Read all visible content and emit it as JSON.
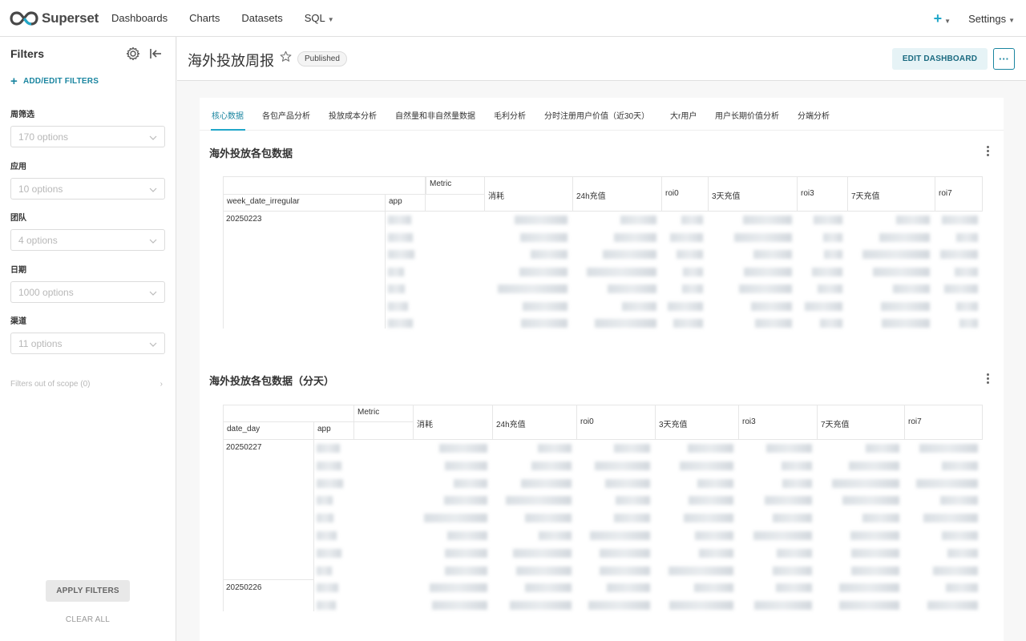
{
  "nav": {
    "brand": "Superset",
    "links": [
      {
        "label": "Dashboards"
      },
      {
        "label": "Charts"
      },
      {
        "label": "Datasets"
      },
      {
        "label": "SQL"
      }
    ],
    "plus": "+",
    "settings": "Settings"
  },
  "sidebar": {
    "title": "Filters",
    "add_filters": "ADD/EDIT FILTERS",
    "filters": [
      {
        "label": "周筛选",
        "placeholder": "170 options"
      },
      {
        "label": "应用",
        "placeholder": "10 options"
      },
      {
        "label": "团队",
        "placeholder": "4 options"
      },
      {
        "label": "日期",
        "placeholder": "1000 options"
      },
      {
        "label": "渠道",
        "placeholder": "11 options"
      }
    ],
    "scope": "Filters out of scope (0)",
    "apply": "APPLY FILTERS",
    "clear": "CLEAR ALL"
  },
  "header": {
    "title": "海外投放周报",
    "badge": "Published",
    "edit": "EDIT DASHBOARD",
    "more": "···"
  },
  "tabs": [
    {
      "label": "核心数据"
    },
    {
      "label": "各包产品分析"
    },
    {
      "label": "投放成本分析"
    },
    {
      "label": "自然量和非自然量数据"
    },
    {
      "label": "毛利分析"
    },
    {
      "label": "分时注册用户价值（近30天）"
    },
    {
      "label": "大r用户"
    },
    {
      "label": "用户长期价值分析"
    },
    {
      "label": "分端分析"
    }
  ],
  "chart1": {
    "title": "海外投放各包数据",
    "metric": "Metric",
    "row_headers": [
      "week_date_irregular",
      "app"
    ],
    "columns": [
      "消耗",
      "24h充值",
      "roi0",
      "3天充值",
      "roi3",
      "7天充值",
      "roi7"
    ],
    "rows": [
      {
        "label": "20250223"
      }
    ]
  },
  "chart2": {
    "title": "海外投放各包数据（分天）",
    "metric": "Metric",
    "row_headers": [
      "date_day",
      "app"
    ],
    "columns": [
      "消耗",
      "24h充值",
      "roi0",
      "3天充值",
      "roi3",
      "7天充值",
      "roi7"
    ],
    "rows": [
      {
        "label": "20250227"
      },
      {
        "label": "20250226"
      }
    ]
  },
  "colors": {
    "accent": "#20a7c9",
    "accent_dark": "#1a85a0"
  }
}
